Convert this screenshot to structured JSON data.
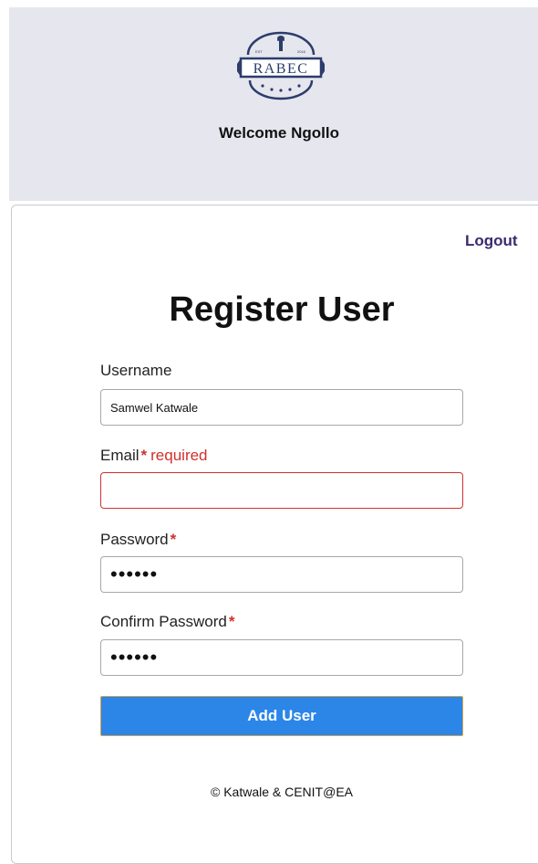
{
  "header": {
    "logo_text": "RABEC",
    "welcome_text": "Welcome Ngollo"
  },
  "nav": {
    "logout_label": "Logout"
  },
  "form": {
    "title": "Register User",
    "username": {
      "label": "Username",
      "value": "Samwel Katwale"
    },
    "email": {
      "label": "Email",
      "required_marker": "*",
      "error_text": "required",
      "value": ""
    },
    "password": {
      "label": "Password",
      "required_marker": "*",
      "value": "••••••"
    },
    "confirm_password": {
      "label": "Confirm Password",
      "required_marker": "*",
      "value": "••••••"
    },
    "submit_label": "Add User"
  },
  "footer": {
    "copyright": "© Katwale & CENIT@EA"
  },
  "colors": {
    "header_bg": "#e6e6ef",
    "button_bg": "#2b86e8",
    "required_red": "#d0312d",
    "logout_purple": "#3b2a6e"
  }
}
